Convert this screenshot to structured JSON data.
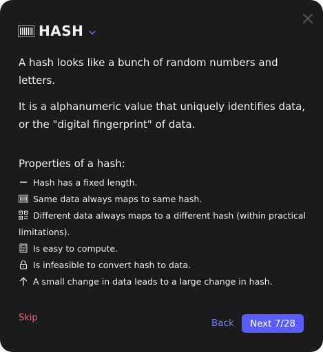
{
  "dialog": {
    "title": "HASH",
    "title_icon": "barcode-icon",
    "dropdown_icon": "chevron-down-icon",
    "close_icon": "close-icon"
  },
  "intro": {
    "paragraph_1": "A hash looks like a bunch of random numbers and letters.",
    "paragraph_2": "It is a alphanumeric value that uniquely identifies data, or the \"digital fingerprint\" of data."
  },
  "properties": {
    "heading": "Properties of a hash:",
    "items": [
      {
        "icon": "dash-icon",
        "text": "Hash has a fixed length."
      },
      {
        "icon": "barcode-icon",
        "text": "Same data always maps to same hash."
      },
      {
        "icon": "qr-code-icon",
        "text": "Different data always maps to a different hash (within practical limitations)."
      },
      {
        "icon": "calculator-icon",
        "text": "Is easy to compute."
      },
      {
        "icon": "lock-icon",
        "text": "Is infeasible to convert hash to data."
      },
      {
        "icon": "arrow-up-icon",
        "text": "A small change in data leads to a large change in hash."
      }
    ]
  },
  "footer": {
    "skip_label": "Skip",
    "back_label": "Back",
    "next_label": "Next 7/28"
  },
  "colors": {
    "background": "#1b1b1d",
    "accent": "#5b5dfa",
    "back_link": "#7d7ff7",
    "skip_link": "#e8697e"
  }
}
